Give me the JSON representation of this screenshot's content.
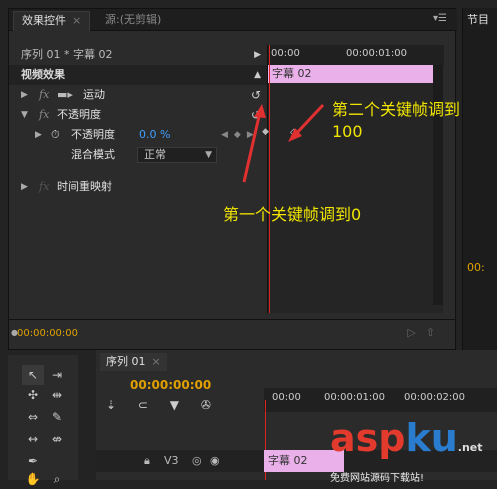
{
  "effect_controls": {
    "tab_label": "效果控件",
    "source_tab_label": "源:(无剪辑)",
    "sequence_label": "序列 01 * 字幕 02",
    "video_effects_label": "视频效果",
    "motion": {
      "fx": "fx",
      "label": "运动"
    },
    "opacity": {
      "fx": "fx",
      "label": "不透明度",
      "param_label": "不透明度",
      "param_value": "0.0 %",
      "blend_label": "混合模式",
      "blend_value": "正常"
    },
    "time_remap": {
      "fx": "fx",
      "label": "时间重映射"
    },
    "timeline": {
      "tick_start": "00:00",
      "tick_mid": "00:00:01:00",
      "clip_label": "字幕 02"
    },
    "current_time": "00:00:00:00"
  },
  "right_panel": {
    "tab_label": "节目",
    "time": "00:"
  },
  "timeline": {
    "tab_label": "序列 01",
    "current_time": "00:00:00:00",
    "ruler": [
      "00:00",
      "00:00:01:00",
      "00:00:02:00"
    ],
    "track_label": "V3",
    "clip_label": "字幕 02"
  },
  "annotations": {
    "second_keyframe_line1": "第二个关键帧调到",
    "second_keyframe_line2": "100",
    "first_keyframe": "第一个关键帧调到0"
  },
  "watermark": {
    "logo_asp": "asp",
    "logo_ku": "ku",
    "logo_net": ".net",
    "subtitle": "免费网站源码下载站!"
  },
  "colors": {
    "annotation": "#f2e600",
    "timecode": "#e0a000",
    "clip": "#e9b0ea",
    "playhead": "#dd2222"
  }
}
